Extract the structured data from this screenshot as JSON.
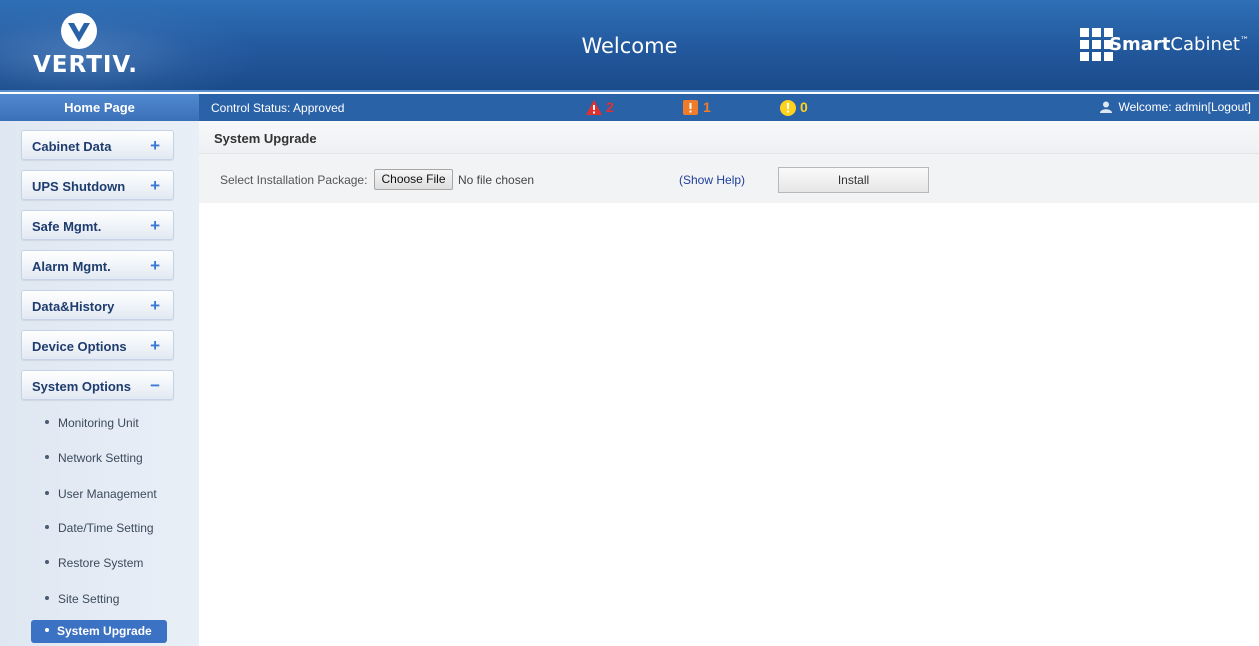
{
  "header": {
    "logo_text": "VERTIV.",
    "title": "Welcome",
    "brand": {
      "bold": "Smart",
      "regular": "Cabinet",
      "mark": "™"
    }
  },
  "status_bar": {
    "home_tab": "Home Page",
    "control_status": "Control Status:  Approved",
    "alarms": {
      "critical": {
        "icon": "critical-alarm-icon",
        "count": "2",
        "color": "#e03030"
      },
      "major": {
        "icon": "major-alarm-icon",
        "count": "1",
        "color": "#f07c2a"
      },
      "minor": {
        "icon": "minor-alarm-icon",
        "count": "0",
        "color": "#ffd21f"
      }
    },
    "user": "Welcome: admin[Logout]"
  },
  "sidebar": {
    "menus": [
      {
        "label": "Cabinet Data",
        "sign": "+"
      },
      {
        "label": "UPS Shutdown",
        "sign": "+"
      },
      {
        "label": "Safe Mgmt.",
        "sign": "+"
      },
      {
        "label": "Alarm Mgmt.",
        "sign": "+"
      },
      {
        "label": "Data&History",
        "sign": "+"
      },
      {
        "label": "Device Options",
        "sign": "+"
      },
      {
        "label": "System Options",
        "sign": "−"
      }
    ],
    "sub_items": [
      "Monitoring Unit",
      "Network Setting",
      "User Management",
      "Date/Time Setting",
      "Restore System",
      "Site Setting"
    ],
    "active_item": "System Upgrade"
  },
  "main": {
    "section_title": "System Upgrade",
    "package_label": "Select Installation Package:",
    "choose_file_label": "Choose File",
    "file_status": "No file chosen",
    "show_help": "(Show Help)",
    "install_label": "Install"
  },
  "colors": {
    "header_blue": "#22589d",
    "status_bar": "#2a62a8",
    "active_item": "#3c72c4",
    "menu_text": "#1e3c6e"
  }
}
